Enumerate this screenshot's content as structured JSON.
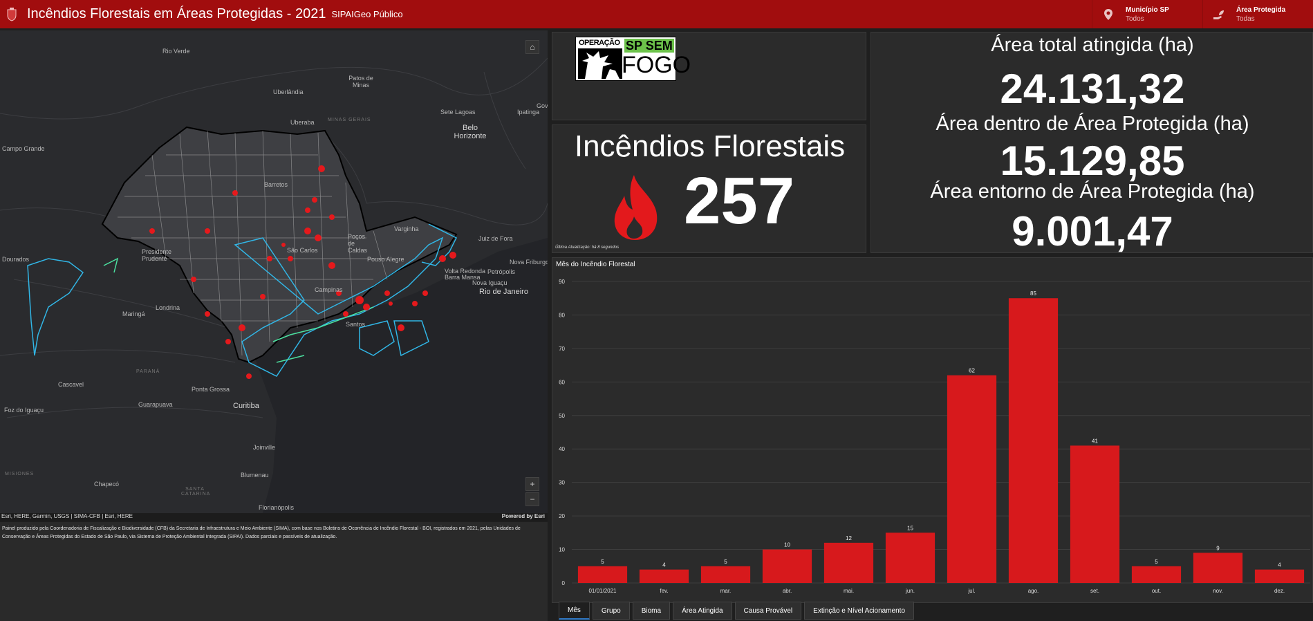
{
  "header": {
    "title": "Incêndios Florestais em Áreas Protegidas - 2021",
    "subtitle": "SIPAIGeo Público",
    "selectors": [
      {
        "label": "Município SP",
        "value": "Todos",
        "icon": "location-pin-icon"
      },
      {
        "label": "Área Protegida",
        "value": "Todas",
        "icon": "plant-hand-icon"
      }
    ]
  },
  "map": {
    "cities": [
      "Rio Verde",
      "Patos de Minas",
      "Uberlândia",
      "Uberaba",
      "Sete Lagoas",
      "Ipatinga",
      "Belo Horizonte",
      "Campo Grande",
      "Varginha",
      "Juiz de Fora",
      "Poços de Caldas",
      "Pouso Alegre",
      "Petrópolis",
      "Nova Friburgo",
      "Volta Redonda",
      "Barra Mansa",
      "Nova Iguaçu",
      "Rio de Janeiro",
      "Dourados",
      "Maringá",
      "Londrina",
      "Cascavel",
      "Ponta Grossa",
      "Guarapuava",
      "Curitiba",
      "Foz do Iguaçu",
      "Joinville",
      "Blumenau",
      "Chapecó",
      "Florianópolis",
      "Presidente Prudente",
      "Barretos",
      "Campinas",
      "Santos",
      "São Carlos"
    ],
    "regions": [
      "MINAS GERAIS",
      "PARANÁ",
      "SANTA CATARINA",
      "MISIONES",
      "Gov. Va"
    ],
    "attribution": "Esri, HERE, Garmin, USGS | SIMA-CFB | Esri, HERE",
    "powered": "Powered by Esri",
    "zoom_in": "+",
    "zoom_out": "−"
  },
  "info_text": "Painel produzido pela Coordenadoria de Fiscalização e Biodiversidade (CFB) da Secretaria de Infraestrutura e Meio Ambiente (SIMA), com base nos Boletins de Ocorrência de Incêndio Florestal - BOI, registrados em 2021, pelas Unidades de Conservação e Áreas Protegidas do Estado de São Paulo, via Sistema de Proteção Ambiental Integrada (SIPAI). Dados parciais e passíveis de atualização.",
  "logo": {
    "op": "OPERAÇÃO",
    "sp": "SP SEM",
    "fogo": "FOGO"
  },
  "fires": {
    "title": "Incêndios Florestais",
    "count": "257",
    "update": "Última Atualização: há 8 segundos"
  },
  "areas": [
    {
      "label": "Área total atingida (ha)",
      "value": "24.131,32"
    },
    {
      "label": "Área dentro de Área Protegida (ha)",
      "value": "15.129,85"
    },
    {
      "label": "Área entorno de Área Protegida (ha)",
      "value": "9.001,47"
    }
  ],
  "chart_data": {
    "type": "bar",
    "title": "Mês do  Incêndio Florestal",
    "categories": [
      "01/01/2021",
      "fev.",
      "mar.",
      "abr.",
      "mai.",
      "jun.",
      "jul.",
      "ago.",
      "set.",
      "out.",
      "nov.",
      "dez."
    ],
    "values": [
      5,
      4,
      5,
      10,
      12,
      15,
      62,
      85,
      41,
      5,
      9,
      4
    ],
    "ylim": [
      0,
      90
    ],
    "yticks": [
      0,
      10,
      20,
      30,
      40,
      50,
      60,
      70,
      80,
      90
    ],
    "bar_color": "#d7191c",
    "grid": true
  },
  "tabs": [
    "Mês",
    "Grupo",
    "Bioma",
    "Área Atingida",
    "Causa Provável",
    "Extinção e Nível Acionamento"
  ]
}
